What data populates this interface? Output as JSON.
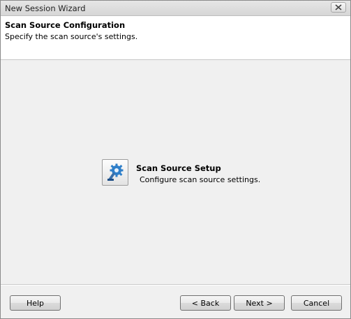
{
  "window": {
    "title": "New Session Wizard",
    "close_icon": "close-icon"
  },
  "header": {
    "title": "Scan Source Configuration",
    "subtitle": "Specify the scan source's settings."
  },
  "main": {
    "setup_icon": "gear-icon",
    "setup_title": "Scan Source Setup",
    "setup_description": "Configure scan source settings."
  },
  "footer": {
    "help_label": "Help",
    "back_label": "< Back",
    "next_label": "Next >",
    "cancel_label": "Cancel"
  }
}
